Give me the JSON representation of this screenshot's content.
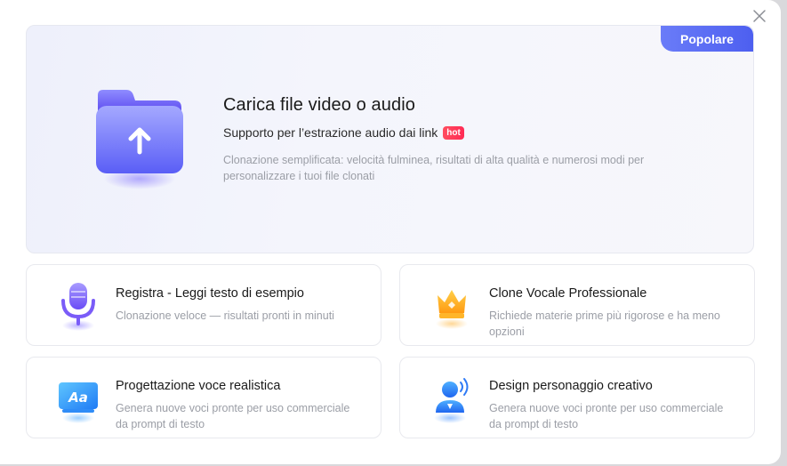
{
  "hero": {
    "badge": "Popolare",
    "title": "Carica file video o audio",
    "subtitle": "Supporto per l’estrazione audio dai link",
    "hot": "hot",
    "description": "Clonazione semplificata: velocità fulminea, risultati di alta qualità e numerosi modi per personalizzare i tuoi file clonati",
    "icon": "folder-upload-icon"
  },
  "cards": [
    {
      "title": "Registra - Leggi testo di esempio",
      "desc": "Clonazione veloce — risultati pronti in minuti",
      "icon": "microphone-icon"
    },
    {
      "title": "Clone Vocale Professionale",
      "desc": "Richiede materie prime più rigorose e ha meno opzioni",
      "icon": "crown-icon"
    },
    {
      "title": "Progettazione voce realistica",
      "desc": "Genera nuove voci pronte per uso commerciale da prompt di testo",
      "icon": "text-display-icon"
    },
    {
      "title": "Design personaggio creativo",
      "desc": "Genera nuove voci pronte per uso commerciale da prompt di testo",
      "icon": "character-voice-icon"
    }
  ],
  "colors": {
    "accent": "#5b6bf5",
    "hot": "#ff3355",
    "crown": "#ffa81c"
  }
}
